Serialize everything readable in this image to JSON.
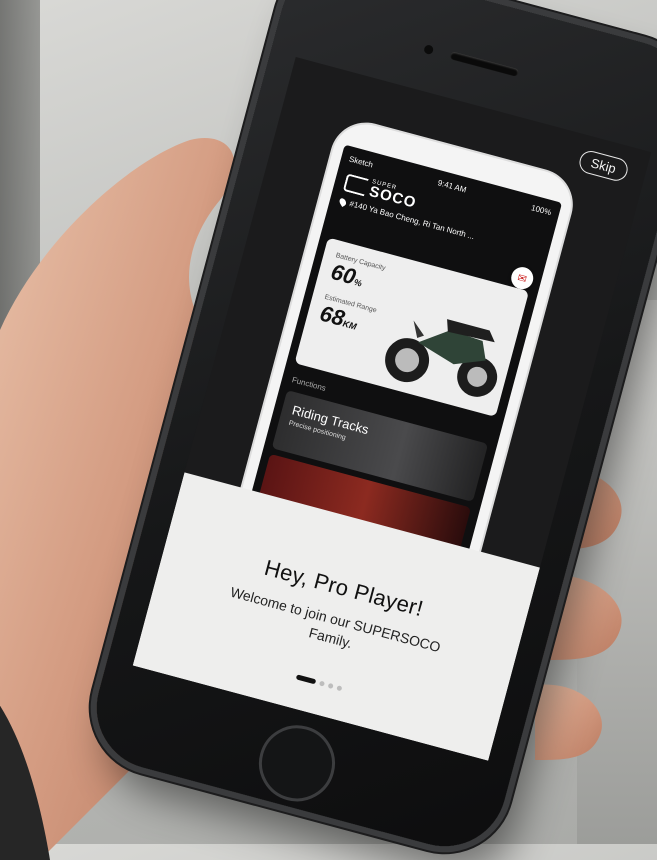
{
  "onboarding": {
    "skip_label": "Skip",
    "title": "Hey, Pro Player!",
    "message": "Welcome to join our SUPERSOCO Family.",
    "page_indicator": {
      "current": 1,
      "total": 4
    }
  },
  "preview_app": {
    "status_left": "Sketch",
    "status_time": "9:41 AM",
    "status_right": "100%",
    "brand_small": "SUPER",
    "brand_large": "SOCO",
    "address": "#140 Ya Bao Cheng, Ri Tan North ...",
    "battery_label": "Battery Capacity",
    "battery_value": "60",
    "battery_unit": "%",
    "range_label": "Estimated Range",
    "range_value": "68",
    "range_unit": "KM",
    "functions_label": "Functions",
    "feature_title": "Riding Tracks",
    "feature_subtitle": "Precise positioning"
  },
  "colors": {
    "panel": "#eeeeed",
    "screen_dark": "#1b1b1c",
    "accent_red": "#cc2222"
  }
}
